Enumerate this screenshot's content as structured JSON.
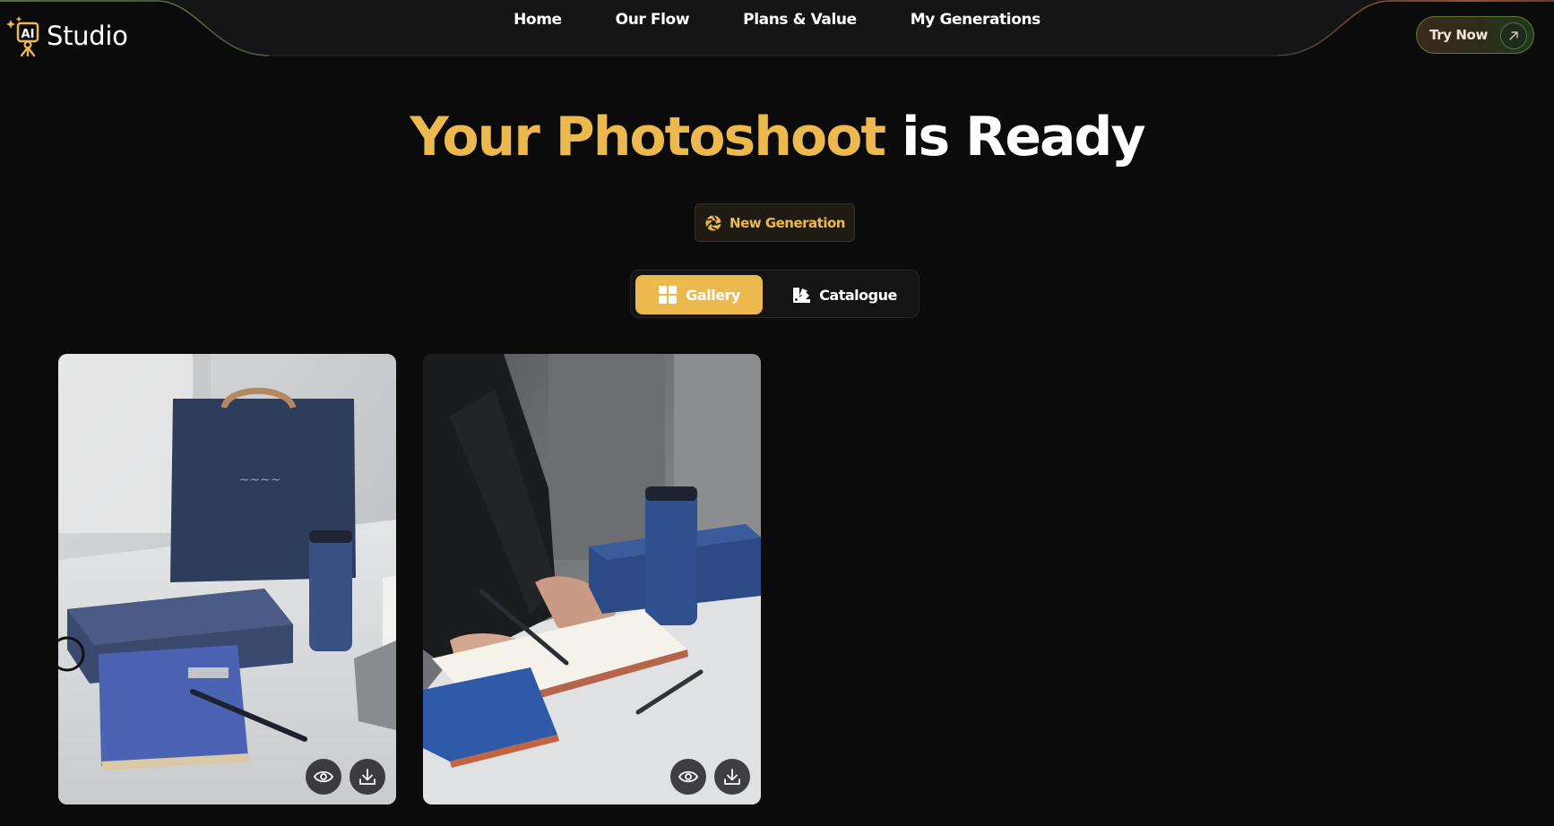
{
  "brand": {
    "logo_mark": "AI",
    "name": "Studio"
  },
  "nav": {
    "links": [
      "Home",
      "Our Flow",
      "Plans & Value",
      "My Generations"
    ],
    "cta_label": "Try Now",
    "cta_icon": "arrow-up-right-icon"
  },
  "hero": {
    "title_highlight": "Your Photoshoot",
    "title_rest": "is Ready"
  },
  "actions": {
    "new_generation_label": "New Generation",
    "new_generation_icon": "aperture-icon"
  },
  "view_toggle": {
    "options": [
      {
        "label": "Gallery",
        "icon": "grid-icon",
        "selected": true
      },
      {
        "label": "Catalogue",
        "icon": "swatch-book-icon",
        "selected": false
      }
    ]
  },
  "gallery": {
    "items": [
      {
        "actions": [
          "eye-icon",
          "download-icon"
        ]
      },
      {
        "actions": [
          "eye-icon",
          "download-icon"
        ]
      }
    ]
  },
  "colors": {
    "background": "#0b0b0c",
    "accent_gold": "#ecb94f",
    "navbar_stroke_green": "#6f8f4a",
    "navbar_stroke_orange": "#c26a3a"
  }
}
